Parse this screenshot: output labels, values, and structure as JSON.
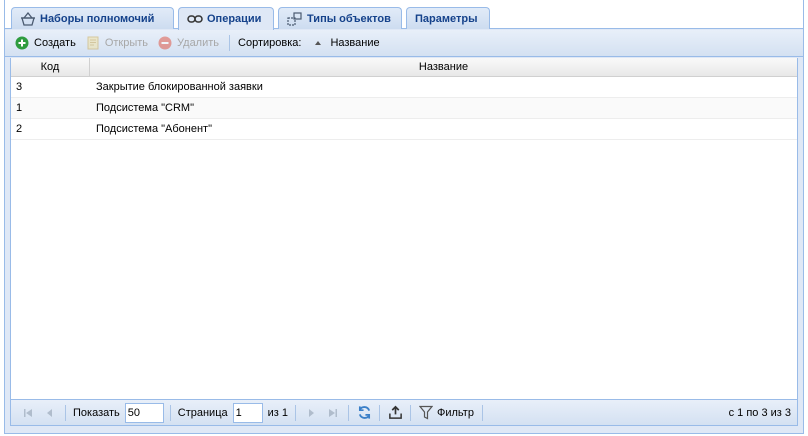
{
  "tabs": [
    {
      "label": "Наборы полномочий",
      "icon": "basket-icon"
    },
    {
      "label": "Операции",
      "icon": "link-icon",
      "active": true
    },
    {
      "label": "Типы объектов",
      "icon": "objects-icon"
    },
    {
      "label": "Параметры",
      "icon": ""
    }
  ],
  "toolbar": {
    "create_label": "Создать",
    "open_label": "Открыть",
    "delete_label": "Удалить",
    "sort_label": "Сортировка:",
    "sort_field": "Название"
  },
  "grid": {
    "columns": [
      "Код",
      "Название"
    ],
    "rows": [
      {
        "code": "3",
        "name": "Закрытие блокированной заявки"
      },
      {
        "code": "1",
        "name": "Подсистема \"CRM\""
      },
      {
        "code": "2",
        "name": "Подсистема \"Абонент\""
      }
    ]
  },
  "pager": {
    "show_label": "Показать",
    "page_size": "50",
    "page_label": "Страница",
    "page_value": "1",
    "of_label": "из 1",
    "filter_label": "Фильтр",
    "info": "с 1 по 3 из 3"
  },
  "colors": {
    "accent": "#15428b",
    "border": "#99bbe8",
    "create": "#2e9c3f",
    "delete": "#e05a4a",
    "refresh": "#3a7fc8"
  }
}
